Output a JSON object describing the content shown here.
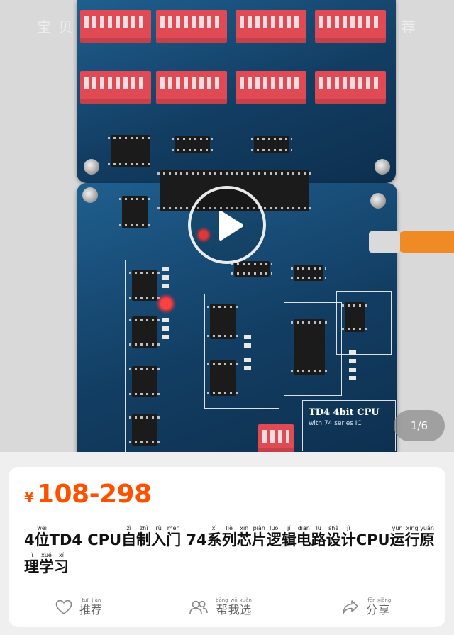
{
  "media": {
    "watermark_left": "宝 贝",
    "watermark_right": "荐",
    "board_title": "TD4 4bit CPU",
    "board_subtitle": "with 74 series IC",
    "page_indicator": "1/6"
  },
  "product": {
    "currency_symbol": "¥",
    "price_range": "108-298",
    "title_tokens": [
      {
        "t": "4"
      },
      {
        "t": "位",
        "py": "wèi"
      },
      {
        "t": "TD4 CPU"
      },
      {
        "t": "自",
        "py": "zì"
      },
      {
        "t": "制",
        "py": "zhì"
      },
      {
        "t": "入",
        "py": "rù"
      },
      {
        "t": "门",
        "py": "mén"
      },
      {
        "t": " 74"
      },
      {
        "t": "系",
        "py": "xì"
      },
      {
        "t": "列",
        "py": "liè"
      },
      {
        "t": "芯",
        "py": "xīn"
      },
      {
        "t": "片",
        "py": "piàn"
      },
      {
        "t": "逻",
        "py": "luó"
      },
      {
        "t": "辑",
        "py": "jí"
      },
      {
        "t": "电",
        "py": "diàn"
      },
      {
        "t": "路",
        "py": "lù"
      },
      {
        "t": "设",
        "py": "shè"
      },
      {
        "t": "计",
        "py": "jì"
      },
      {
        "t": "CPU"
      },
      {
        "t": "运",
        "py": "yùn"
      },
      {
        "t": "行",
        "py": "xíng"
      },
      {
        "t": "原",
        "py": "yuán"
      },
      {
        "t": "理",
        "py": "lǐ"
      },
      {
        "t": "学",
        "py": "xué"
      },
      {
        "t": "习",
        "py": "xí"
      }
    ]
  },
  "actions": {
    "recommend": {
      "chars": [
        {
          "t": "推",
          "py": "tuī"
        },
        {
          "t": "荐",
          "py": "jiàn"
        }
      ],
      "icon": "heart-icon"
    },
    "help_choose": {
      "chars": [
        {
          "t": "帮",
          "py": "bāng"
        },
        {
          "t": "我",
          "py": "wǒ"
        },
        {
          "t": "选",
          "py": "xuǎn"
        }
      ],
      "icon": "people-icon"
    },
    "share": {
      "chars": [
        {
          "t": "分",
          "py": "fēn"
        },
        {
          "t": "享",
          "py": "xiǎng"
        }
      ],
      "icon": "share-arrow-icon"
    }
  },
  "colors": {
    "price": "#ff5000",
    "card_background": "#ffffff",
    "page_background": "#efefef"
  }
}
